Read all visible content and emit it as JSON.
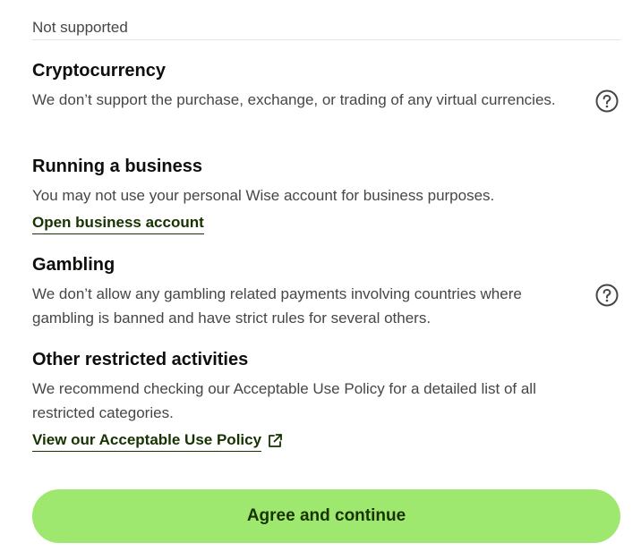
{
  "section_header": "Not supported",
  "items": [
    {
      "title": "Cryptocurrency",
      "description": "We don’t support the purchase, exchange, or trading of any virtual currencies.",
      "icon": "help-circle-icon"
    },
    {
      "title": "Running a business",
      "description": "You may not use your personal Wise account for business purposes.",
      "link": "Open business account"
    },
    {
      "title": "Gambling",
      "description": "We don’t allow any gambling related payments involving countries where gambling is banned and have strict rules for several others.",
      "icon": "help-circle-icon"
    },
    {
      "title": "Other restricted activities",
      "description": "We recommend checking our Acceptable Use Policy for a detailed list of all restricted categories.",
      "link": "View our Acceptable Use Policy",
      "link_icon": "external-link-icon"
    }
  ],
  "button": {
    "label": "Agree and continue"
  },
  "colors": {
    "accent": "#9fe870",
    "link": "#163300",
    "text_primary": "#0e0f0c",
    "text_secondary": "#454745"
  }
}
